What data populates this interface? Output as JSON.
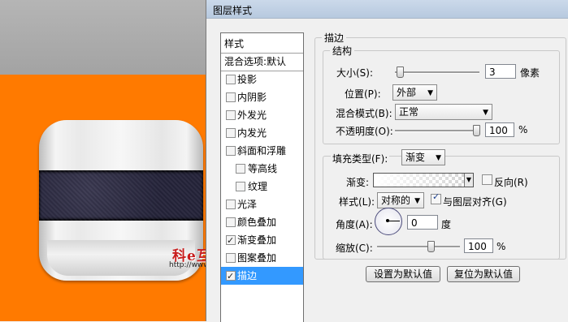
{
  "watermark": {
    "text": "科e互联",
    "url": "http://www.internetke.com"
  },
  "dialog": {
    "title": "图层样式",
    "style_list": [
      {
        "label": "样式",
        "type": "head"
      },
      {
        "label": "混合选项:默认",
        "type": "head"
      },
      {
        "label": "投影",
        "checked": false
      },
      {
        "label": "内阴影",
        "checked": false
      },
      {
        "label": "外发光",
        "checked": false
      },
      {
        "label": "内发光",
        "checked": false
      },
      {
        "label": "斜面和浮雕",
        "checked": false
      },
      {
        "label": "等高线",
        "checked": false,
        "sub": true
      },
      {
        "label": "纹理",
        "checked": false,
        "sub": true
      },
      {
        "label": "光泽",
        "checked": false
      },
      {
        "label": "颜色叠加",
        "checked": false
      },
      {
        "label": "渐变叠加",
        "checked": true
      },
      {
        "label": "图案叠加",
        "checked": false
      },
      {
        "label": "描边",
        "checked": true,
        "selected": true
      }
    ],
    "stroke": {
      "section_title": "描边",
      "structure_title": "结构",
      "size_label": "大小(S):",
      "size_value": "3",
      "size_slider": 0.02,
      "size_unit": "像素",
      "position_label": "位置(P):",
      "position_value": "外部",
      "blend_label": "混合模式(B):",
      "blend_value": "正常",
      "opacity_label": "不透明度(O):",
      "opacity_value": "100",
      "opacity_slider": 1.0,
      "opacity_unit": "%",
      "fill_type_label": "填充类型(F):",
      "fill_type_value": "渐变",
      "gradient_label": "渐变:",
      "reverse_label": "反向(R)",
      "reverse_checked": false,
      "style_label": "样式(L):",
      "style_value": "对称的",
      "align_label": "与图层对齐(G)",
      "align_checked": true,
      "angle_label": "角度(A):",
      "angle_value": "0",
      "angle_unit": "度",
      "scale_label": "缩放(C):",
      "scale_value": "100",
      "scale_slider": 0.66,
      "scale_unit": "%",
      "btn_set_default": "设置为默认值",
      "btn_reset_default": "复位为默认值"
    }
  },
  "colors": {
    "canvas_bg": "#ff7a00",
    "selected_row": "#3399ff",
    "strap": "#25243a"
  }
}
